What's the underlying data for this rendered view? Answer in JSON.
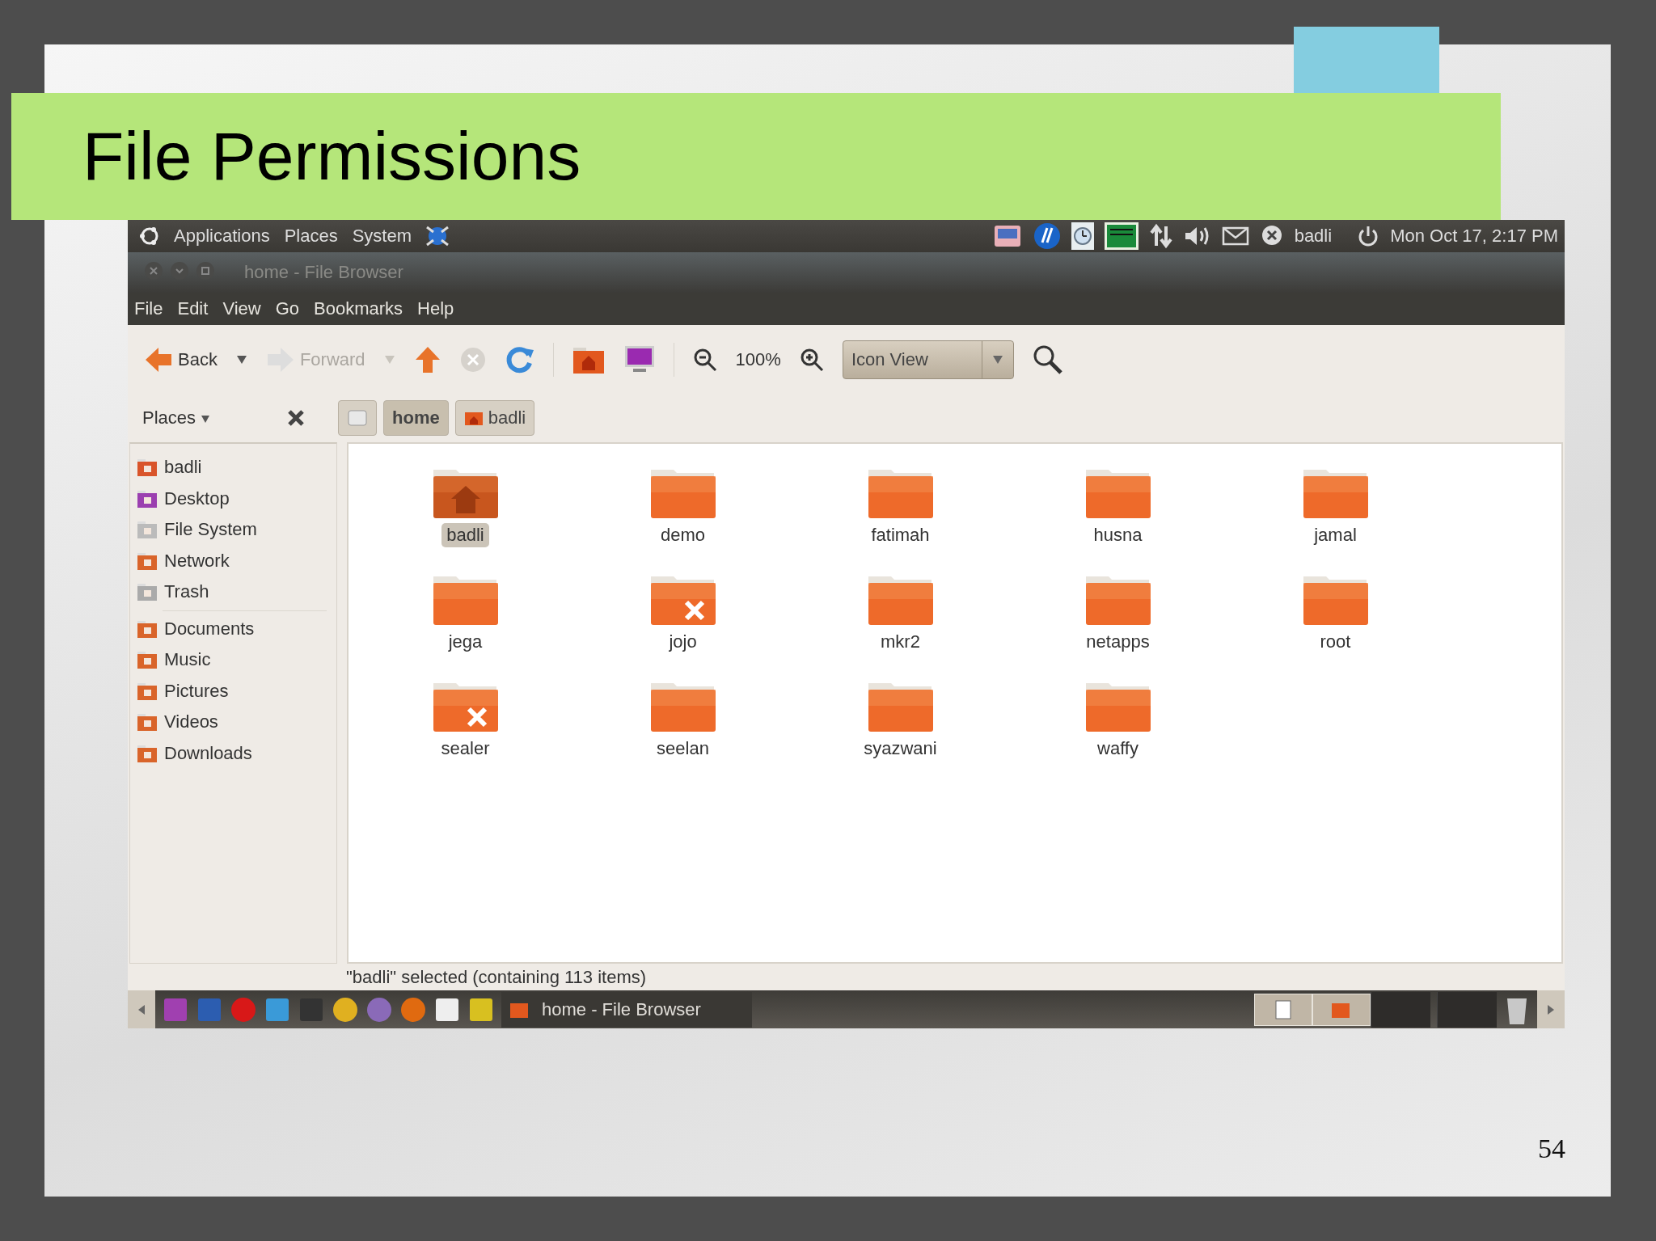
{
  "slide": {
    "title": "File Permissions",
    "page_number": "54"
  },
  "top_panel": {
    "menus": [
      "Applications",
      "Places",
      "System"
    ],
    "user": "badli",
    "clock": "Mon Oct 17,  2:17 PM"
  },
  "window": {
    "title": "home - File Browser"
  },
  "menu_bar": [
    "File",
    "Edit",
    "View",
    "Go",
    "Bookmarks",
    "Help"
  ],
  "toolbar": {
    "nav": [
      {
        "kind": "back",
        "label": "Back",
        "disabled": false
      },
      {
        "kind": "forward",
        "label": "Forward",
        "disabled": true
      }
    ],
    "zoom": "100%",
    "view": "Icon View"
  },
  "sidebar": {
    "header": "Places",
    "groups": [
      [
        "badli",
        "Desktop",
        "File System",
        "Network",
        "Trash"
      ],
      [
        "Documents",
        "Music",
        "Pictures",
        "Videos",
        "Downloads"
      ]
    ]
  },
  "breadcrumbs": [
    {
      "label": "home",
      "selected": true
    },
    {
      "label": "badli",
      "selected": false
    }
  ],
  "files": [
    {
      "name": "badli",
      "kind": "home",
      "selected": true,
      "no_access": false
    },
    {
      "name": "demo",
      "kind": "folder",
      "selected": false,
      "no_access": false
    },
    {
      "name": "fatimah",
      "kind": "folder",
      "selected": false,
      "no_access": false
    },
    {
      "name": "husna",
      "kind": "folder",
      "selected": false,
      "no_access": false
    },
    {
      "name": "jamal",
      "kind": "folder",
      "selected": false,
      "no_access": false
    },
    {
      "name": "jega",
      "kind": "folder",
      "selected": false,
      "no_access": false
    },
    {
      "name": "jojo",
      "kind": "folder",
      "selected": false,
      "no_access": true
    },
    {
      "name": "mkr2",
      "kind": "folder",
      "selected": false,
      "no_access": false
    },
    {
      "name": "netapps",
      "kind": "folder",
      "selected": false,
      "no_access": false
    },
    {
      "name": "root",
      "kind": "folder",
      "selected": false,
      "no_access": false
    },
    {
      "name": "sealer",
      "kind": "folder",
      "selected": false,
      "no_access": true
    },
    {
      "name": "seelan",
      "kind": "folder",
      "selected": false,
      "no_access": false
    },
    {
      "name": "syazwani",
      "kind": "folder",
      "selected": false,
      "no_access": false
    },
    {
      "name": "waffy",
      "kind": "folder",
      "selected": false,
      "no_access": false
    }
  ],
  "status": "\"badli\" selected (containing 113 items)",
  "taskbar": {
    "tasks": [
      {
        "label": "home - File Browser"
      }
    ]
  }
}
